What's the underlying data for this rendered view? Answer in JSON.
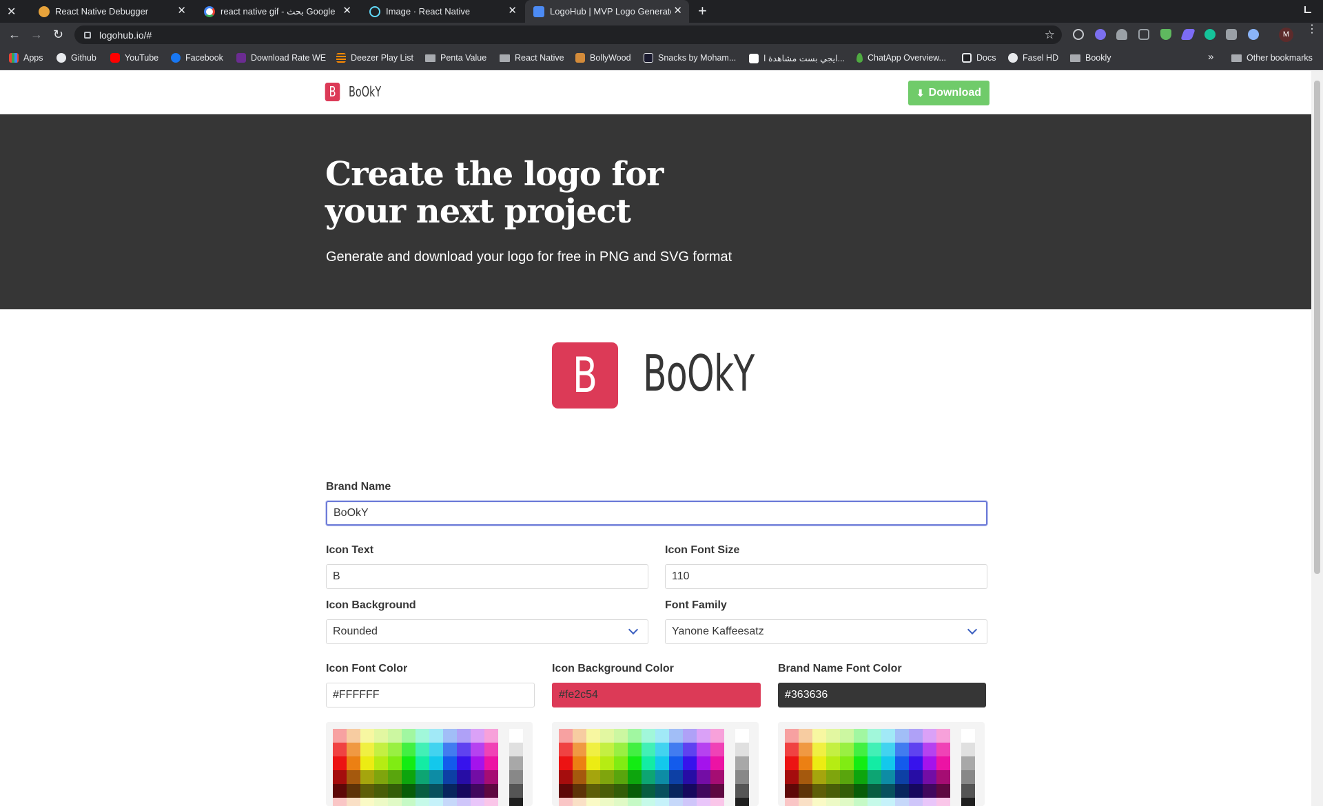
{
  "browser": {
    "tabs": [
      {
        "title": "React Native Debugger",
        "favicon": "gear-icon",
        "color": "#e8a33b",
        "active": false
      },
      {
        "title": "react native gif - بحث Google",
        "favicon": "google-icon",
        "color": "#ffffff",
        "active": false
      },
      {
        "title": "Image · React Native",
        "favicon": "react-icon",
        "color": "#61dafb",
        "active": false
      },
      {
        "title": "LogoHub | MVP Logo Generator",
        "favicon": "logohub-icon",
        "color": "#4c8bf5",
        "active": true
      }
    ],
    "new_tab_glyph": "+",
    "url": "logohub.io/#",
    "bookmarks": [
      {
        "label": "Apps",
        "icon": "apps-grid-icon"
      },
      {
        "label": "Github",
        "icon": "github-icon"
      },
      {
        "label": "YouTube",
        "icon": "youtube-icon"
      },
      {
        "label": "Facebook",
        "icon": "facebook-icon"
      },
      {
        "label": "Download Rate WE",
        "icon": "we-icon"
      },
      {
        "label": "Deezer Play List",
        "icon": "deezer-icon"
      },
      {
        "label": "Penta Value",
        "icon": "folder-icon"
      },
      {
        "label": "React Native",
        "icon": "folder-icon"
      },
      {
        "label": "BollyWood",
        "icon": "bollywood-icon"
      },
      {
        "label": "Snacks by Moham...",
        "icon": "expo-icon"
      },
      {
        "label": "ايجي بست مشاهدة ا...",
        "icon": "egybest-icon"
      },
      {
        "label": "ChatApp Overview...",
        "icon": "mongodb-icon"
      },
      {
        "label": "Docs",
        "icon": "docs-icon"
      },
      {
        "label": "Fasel HD",
        "icon": "globe-icon"
      },
      {
        "label": "Bookly",
        "icon": "folder-icon"
      }
    ],
    "more_bookmarks": "»",
    "other_bookmarks": "Other bookmarks",
    "profile_initial": "M"
  },
  "site": {
    "nav": {
      "brand": "BoOkY",
      "icon_text": "B",
      "download_label": "Download"
    },
    "hero": {
      "title": "Create the logo for your next project",
      "subtitle": "Generate and download your logo for free in PNG and SVG format"
    },
    "preview": {
      "icon_text": "B",
      "brand": "BoOkY"
    },
    "form": {
      "brand_name": {
        "label": "Brand Name",
        "value": "BoOkY"
      },
      "icon_text": {
        "label": "Icon Text",
        "value": "B"
      },
      "icon_font_size": {
        "label": "Icon Font Size",
        "value": "110"
      },
      "icon_background": {
        "label": "Icon Background",
        "value": "Rounded"
      },
      "font_family": {
        "label": "Font Family",
        "value": "Yanone Kaffeesatz"
      },
      "icon_font_color": {
        "label": "Icon Font Color",
        "value": "#FFFFFF"
      },
      "icon_background_color": {
        "label": "Icon Background Color",
        "value": "#fe2c54"
      },
      "brand_name_font_color": {
        "label": "Brand Name Font Color",
        "value": "#363636"
      }
    }
  },
  "colors": {
    "icon_bg": "#dc3a57",
    "brand_text": "#363636",
    "hero_bg": "#363636",
    "download_btn": "#70cb6a",
    "swatch_field_bg_red": "#dc3a57",
    "swatch_field_bg_dark": "#363636"
  }
}
